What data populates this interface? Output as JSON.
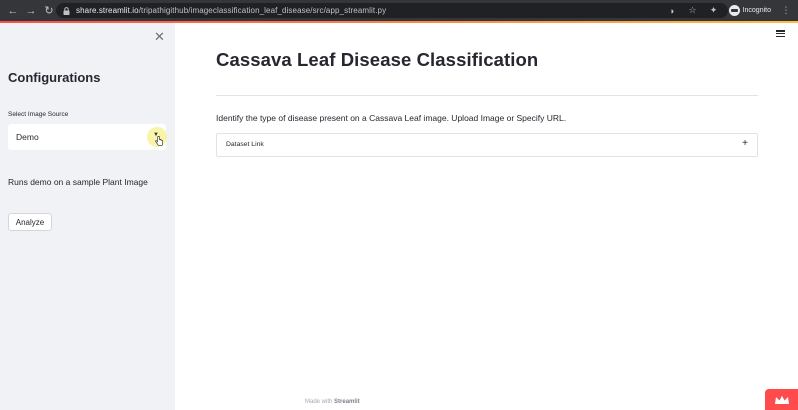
{
  "browser": {
    "url_host": "share.streamlit.io",
    "url_path": "/tripathigithub/imageclassification_leaf_disease/src/app_streamlit.py",
    "profile_label": "Incognito"
  },
  "sidebar": {
    "title": "Configurations",
    "select_label": "Select Image Source",
    "select_value": "Demo",
    "description": "Runs demo on a sample Plant Image",
    "analyze_button": "Analyze"
  },
  "main": {
    "title": "Cassava Leaf Disease Classification",
    "intro": "Identify the type of disease present on a Cassava Leaf image. Upload Image or Specify URL.",
    "expander_label": "Dataset Link",
    "footer_prefix": "Made with",
    "footer_brand": "Streamlit"
  },
  "colors": {
    "accent": "#ff4b4b",
    "sidebar_bg": "#f0f2f6",
    "text": "#262730"
  }
}
